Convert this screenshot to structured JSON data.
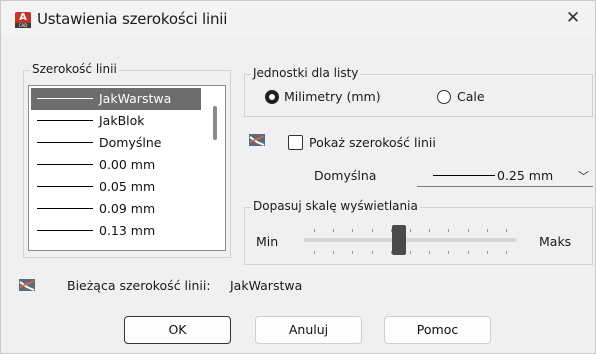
{
  "window": {
    "title": "Ustawienia szerokości linii",
    "close_glyph": "✕",
    "app_icon_letter": "A",
    "app_icon_sub": "CAD"
  },
  "lineweights": {
    "group_title": "Szerokość linii",
    "items": [
      {
        "label": "JakWarstwa",
        "selected": true
      },
      {
        "label": "JakBlok",
        "selected": false
      },
      {
        "label": "Domyślne",
        "selected": false
      },
      {
        "label": "0.00 mm",
        "selected": false
      },
      {
        "label": "0.05 mm",
        "selected": false
      },
      {
        "label": "0.09 mm",
        "selected": false
      },
      {
        "label": "0.13 mm",
        "selected": false
      }
    ]
  },
  "units": {
    "group_title": "Jednostki dla listy",
    "options": [
      {
        "label": "Milimetry (mm)",
        "checked": true
      },
      {
        "label": "Cale",
        "checked": false
      }
    ]
  },
  "display": {
    "show_label": "Pokaż szerokość linii",
    "show_checked": false,
    "default_label": "Domyślna",
    "default_value": "0.25 mm"
  },
  "scale": {
    "group_title": "Dopasuj skalę wyświetlania",
    "min_label": "Min",
    "max_label": "Maks",
    "value_fraction": 0.45
  },
  "status": {
    "current_label": "Bieżąca szerokość linii:",
    "current_value": "JakWarstwa"
  },
  "buttons": {
    "ok": "OK",
    "cancel": "Anuluj",
    "help": "Pomoc"
  }
}
